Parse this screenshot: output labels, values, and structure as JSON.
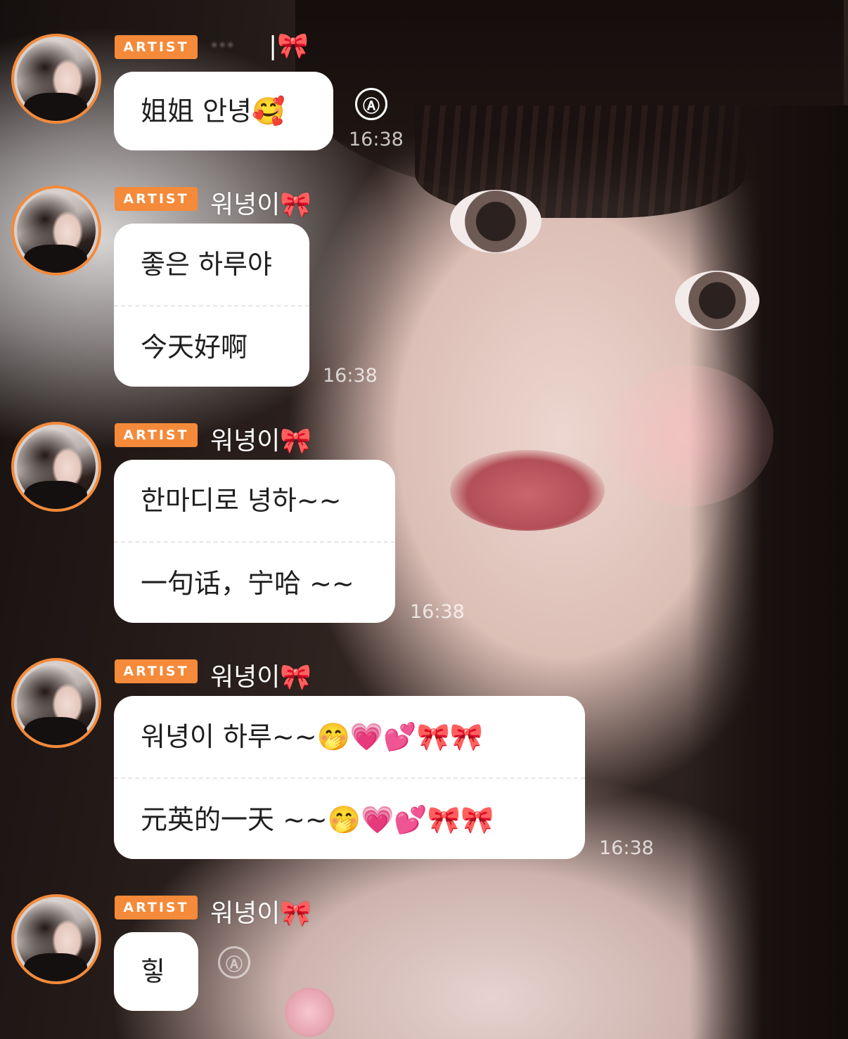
{
  "badge_label": "ARTIST",
  "messages": [
    {
      "sender": "··· ",
      "sender_suffix": "|🎀",
      "lines": [
        "姐姐 안녕🥰"
      ],
      "time": "16:38",
      "translate_icon": "Ⓐ"
    },
    {
      "sender": "워녕이🎀",
      "lines": [
        "좋은 하루야",
        "今天好啊"
      ],
      "time": "16:38"
    },
    {
      "sender": "워녕이🎀",
      "lines": [
        "한마디로 녕하~~",
        "一句话，宁哈 ~~"
      ],
      "time": "16:38"
    },
    {
      "sender": "워녕이🎀",
      "lines": [
        "워녕이 하루~~🤭💗💕🎀🎀",
        "元英的一天 ~~🤭💗💕🎀🎀"
      ],
      "time": "16:38"
    },
    {
      "sender": "워녕이🎀",
      "lines": [
        "힣"
      ],
      "translate_icon": "Ⓐ"
    }
  ],
  "colors": {
    "badge": "#f48a3a",
    "avatar_ring": "#f48a3a",
    "bubble": "#ffffff",
    "text": "#1f1f1f"
  },
  "icons": {
    "translate": "translate-a-icon",
    "bow": "ribbon-icon"
  }
}
